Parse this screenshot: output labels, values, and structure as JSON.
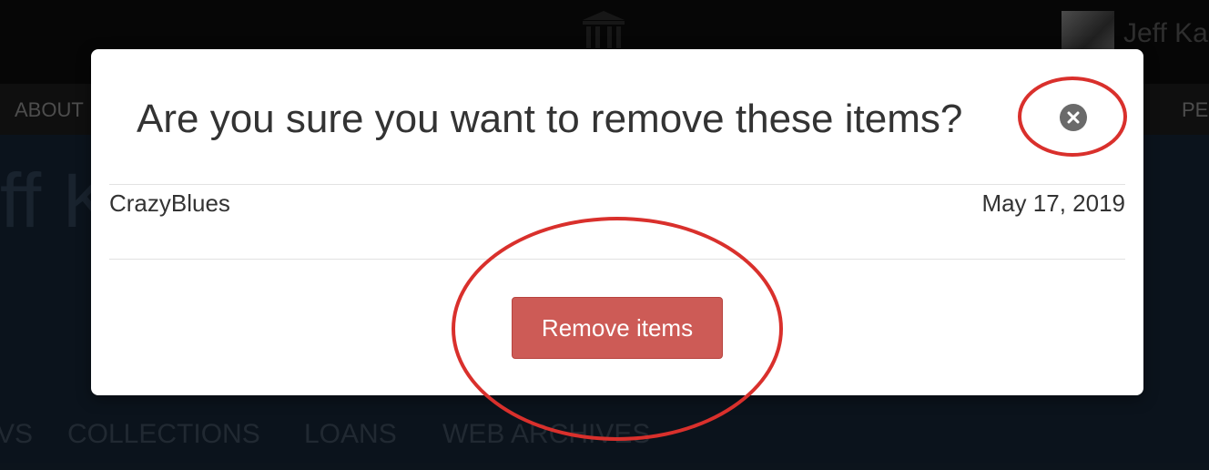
{
  "header": {
    "logo_icon": "institution-columns-icon",
    "user_name": "Jeff Ka"
  },
  "nav": {
    "items": [
      {
        "label": "ABOUT"
      },
      {
        "label": "PE"
      }
    ]
  },
  "page": {
    "title_fragment": "ff K"
  },
  "tabs": [
    {
      "label": "VS"
    },
    {
      "label": "COLLECTIONS"
    },
    {
      "label": "LOANS"
    },
    {
      "label": "WEB ARCHIVES"
    }
  ],
  "modal": {
    "title": "Are you sure you want to remove these items?",
    "close_icon": "close-circle-icon",
    "items": [
      {
        "name": "CrazyBlues",
        "date": "May 17, 2019"
      }
    ],
    "remove_button_label": "Remove items"
  },
  "colors": {
    "danger_button": "#cd5b56",
    "annotation": "#d9302c"
  }
}
